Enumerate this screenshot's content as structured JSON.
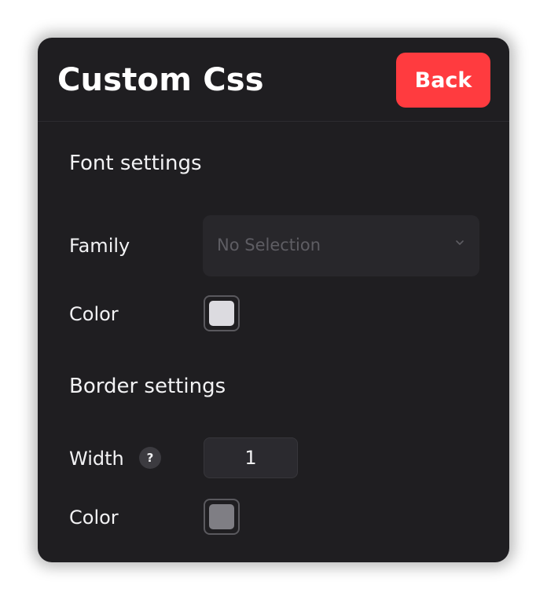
{
  "header": {
    "title": "Custom Css",
    "back_label": "Back"
  },
  "font_settings": {
    "section_title": "Font settings",
    "family_label": "Family",
    "family_value": "No Selection",
    "color_label": "Color",
    "color_value": "#dcdbe0"
  },
  "border_settings": {
    "section_title": "Border settings",
    "width_label": "Width",
    "help_glyph": "?",
    "width_value": "1",
    "color_label": "Color",
    "color_value": "#7f7e84"
  },
  "colors": {
    "panel_bg": "#1f1e21",
    "accent": "#ff3b3f"
  }
}
